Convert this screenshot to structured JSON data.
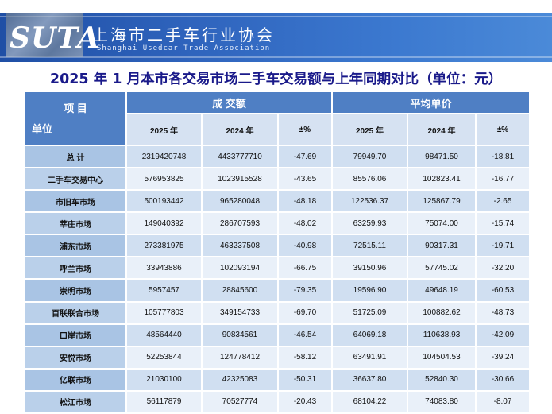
{
  "header": {
    "logo": "SUTA",
    "org_name": "上海市二手车行业协会",
    "org_name_en": "Shanghai Usedcar Trade Association"
  },
  "title": "2025 年 1 月本市各交易市场二手车交易额与上年同期对比（单位：元）",
  "table": {
    "corner_top": "项 目",
    "corner_bottom": "单位",
    "group1": "成 交额",
    "group2": "平均单价",
    "sub_headers": [
      "2025 年",
      "2024 年",
      "±%",
      "2025 年",
      "2024 年",
      "±%"
    ],
    "rows": [
      {
        "label": "总 计",
        "cells": [
          "2319420748",
          "4433777710",
          "-47.69",
          "79949.70",
          "98471.50",
          "-18.81"
        ]
      },
      {
        "label": "二手车交易中心",
        "cells": [
          "576953825",
          "1023915528",
          "-43.65",
          "85576.06",
          "102823.41",
          "-16.77"
        ]
      },
      {
        "label": "市旧车市场",
        "cells": [
          "500193442",
          "965280048",
          "-48.18",
          "122536.37",
          "125867.79",
          "-2.65"
        ]
      },
      {
        "label": "莘庄市场",
        "cells": [
          "149040392",
          "286707593",
          "-48.02",
          "63259.93",
          "75074.00",
          "-15.74"
        ]
      },
      {
        "label": "浦东市场",
        "cells": [
          "273381975",
          "463237508",
          "-40.98",
          "72515.11",
          "90317.31",
          "-19.71"
        ]
      },
      {
        "label": "呼兰市场",
        "cells": [
          "33943886",
          "102093194",
          "-66.75",
          "39150.96",
          "57745.02",
          "-32.20"
        ]
      },
      {
        "label": "崇明市场",
        "cells": [
          "5957457",
          "28845600",
          "-79.35",
          "19596.90",
          "49648.19",
          "-60.53"
        ]
      },
      {
        "label": "百联联合市场",
        "cells": [
          "105777803",
          "349154733",
          "-69.70",
          "51725.09",
          "100882.62",
          "-48.73"
        ]
      },
      {
        "label": "口岸市场",
        "cells": [
          "48564440",
          "90834561",
          "-46.54",
          "64069.18",
          "110638.93",
          "-42.09"
        ]
      },
      {
        "label": "安悦市场",
        "cells": [
          "52253844",
          "124778412",
          "-58.12",
          "63491.91",
          "104504.53",
          "-39.24"
        ]
      },
      {
        "label": "亿联市场",
        "cells": [
          "21030100",
          "42325083",
          "-50.31",
          "36637.80",
          "52840.30",
          "-30.66"
        ]
      },
      {
        "label": "松江市场",
        "cells": [
          "56117879",
          "70527774",
          "-20.43",
          "68104.22",
          "74083.80",
          "-8.07"
        ]
      }
    ]
  }
}
